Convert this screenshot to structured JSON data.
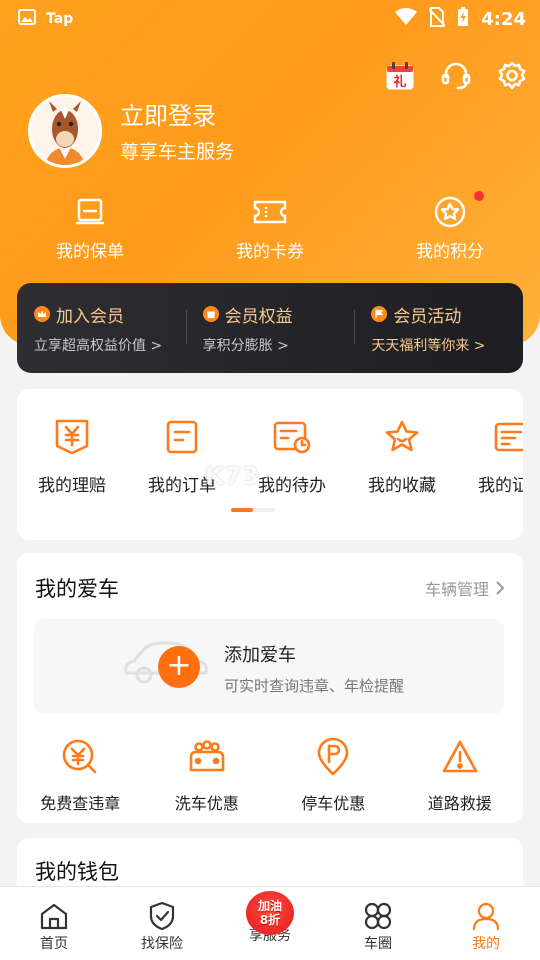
{
  "status_bar": {
    "app_label": "Tap",
    "time": "4:24"
  },
  "profile": {
    "login_title": "立即登录",
    "login_subtitle": "尊享车主服务"
  },
  "gift_icon_text": "礼",
  "quick_actions": [
    {
      "label": "我的保单",
      "icon": "policy-icon"
    },
    {
      "label": "我的卡券",
      "icon": "ticket-icon"
    },
    {
      "label": "我的积分",
      "icon": "points-icon"
    }
  ],
  "member": [
    {
      "title": "加入会员",
      "subtitle": "立享超高权益价值 >"
    },
    {
      "title": "会员权益",
      "subtitle": "享积分膨胀 >"
    },
    {
      "title": "会员活动",
      "subtitle": "天天福利等你来 >"
    }
  ],
  "services": [
    {
      "label": "我的理赔",
      "icon": "claim-icon"
    },
    {
      "label": "我的订单",
      "icon": "order-icon"
    },
    {
      "label": "我的待办",
      "icon": "todo-icon"
    },
    {
      "label": "我的收藏",
      "icon": "star-icon"
    },
    {
      "label": "我的证件",
      "icon": "id-card-icon"
    }
  ],
  "watermark": "K73",
  "my_car": {
    "title": "我的爱车",
    "manage_link": "车辆管理",
    "add_title": "添加爱车",
    "add_subtitle": "可实时查询违章、年检提醒",
    "plus_symbol": "+"
  },
  "car_tools": [
    {
      "label": "免费查违章",
      "icon": "violation-icon"
    },
    {
      "label": "洗车优惠",
      "icon": "car-wash-icon"
    },
    {
      "label": "停车优惠",
      "icon": "parking-icon"
    },
    {
      "label": "道路救援",
      "icon": "warning-icon"
    }
  ],
  "wallet": {
    "title": "我的钱包"
  },
  "tabs": [
    {
      "label": "首页",
      "icon": "home-icon"
    },
    {
      "label": "找保险",
      "icon": "shield-icon"
    },
    {
      "label": "享服务",
      "icon": "promo-icon",
      "promo_line1": "加油",
      "promo_line2": "8折"
    },
    {
      "label": "车圈",
      "icon": "circle-grid-icon"
    },
    {
      "label": "我的",
      "icon": "user-icon"
    }
  ],
  "colors": {
    "accent": "#ff7a1a",
    "header": "#ffa21e",
    "member_bg": "#2a2a2e",
    "member_text": "#f7c98d"
  }
}
